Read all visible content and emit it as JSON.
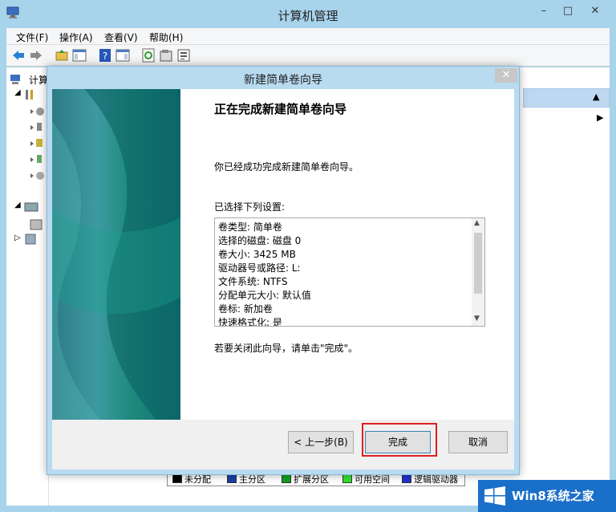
{
  "main_window": {
    "title": "计算机管理",
    "controls": {
      "minimize": "–",
      "maximize": "□",
      "close": "✕"
    },
    "menu": [
      "文件(F)",
      "操作(A)",
      "查看(V)",
      "帮助(H)"
    ],
    "tree_label": "计算",
    "legend": [
      {
        "label": "未分配",
        "color": "#000000"
      },
      {
        "label": "主分区",
        "color": "#1a3ea8"
      },
      {
        "label": "扩展分区",
        "color": "#10a020"
      },
      {
        "label": "可用空间",
        "color": "#30e030"
      },
      {
        "label": "逻辑驱动器",
        "color": "#2030d0"
      }
    ]
  },
  "dialog": {
    "title": "新建简单卷向导",
    "close": "✕",
    "heading": "正在完成新建简单卷向导",
    "done_text": "你已经成功完成新建简单卷向导。",
    "settings_label": "已选择下列设置:",
    "settings": [
      "卷类型: 简单卷",
      "选择的磁盘: 磁盘 0",
      "卷大小: 3425 MB",
      "驱动器号或路径: L:",
      "文件系统: NTFS",
      "分配单元大小: 默认值",
      "卷标: 新加卷",
      "快速格式化: 是"
    ],
    "close_hint": "若要关闭此向导，请单击\"完成\"。",
    "buttons": {
      "back": "< 上一步(B)",
      "finish": "完成",
      "cancel": "取消"
    },
    "highlight_color": "#e02020"
  },
  "watermark": {
    "text": "Win8系统之家"
  }
}
